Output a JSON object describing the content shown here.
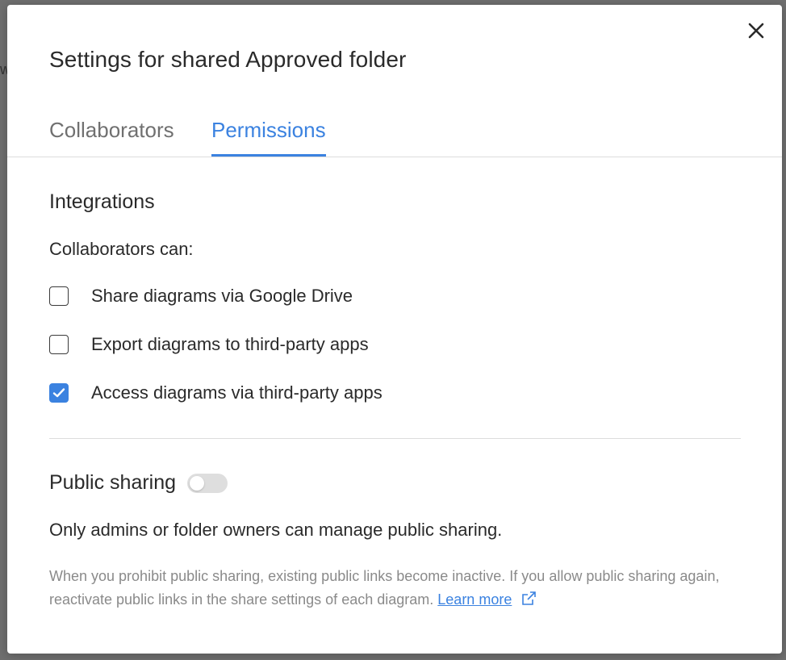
{
  "backdrop": {
    "fragment": "w"
  },
  "dialog": {
    "title": "Settings for shared Approved folder",
    "close_icon": "close-icon"
  },
  "tabs": [
    {
      "label": "Collaborators",
      "active": false
    },
    {
      "label": "Permissions",
      "active": true
    }
  ],
  "integrations": {
    "heading": "Integrations",
    "subheading": "Collaborators can:",
    "options": [
      {
        "label": "Share diagrams via Google Drive",
        "checked": false
      },
      {
        "label": "Export diagrams to third-party apps",
        "checked": false
      },
      {
        "label": "Access diagrams via third-party apps",
        "checked": true
      }
    ]
  },
  "public_sharing": {
    "heading": "Public sharing",
    "enabled": false,
    "note": "Only admins or folder owners can manage public sharing.",
    "help_text": "When you prohibit public sharing, existing public links become inactive. If you allow public sharing again, reactivate public links in the share settings of each diagram.",
    "learn_more_label": "Learn more",
    "external_icon": "external-link-icon"
  },
  "colors": {
    "accent": "#3b82e0",
    "text": "#2a2a2a",
    "muted": "#707070",
    "toggle_off": "#dedede"
  }
}
